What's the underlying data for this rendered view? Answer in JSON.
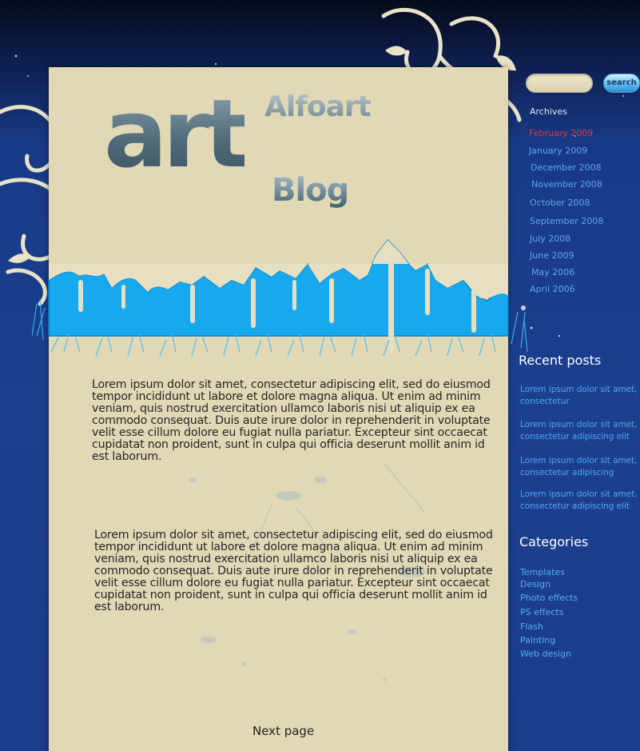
{
  "logo": {
    "art": "art",
    "name": "Alfoart",
    "blog": "Blog"
  },
  "articles": [
    "Lorem ipsum dolor sit amet, consectetur adipiscing elit, sed do eiusmod tempor incididunt ut labore et dolore magna aliqua. Ut enim ad minim veniam, quis nostrud exercitation ullamco laboris nisi ut aliquip ex ea commodo consequat. Duis aute irure dolor in reprehenderit in voluptate velit esse cillum dolore eu fugiat nulla pariatur. Excepteur sint occaecat cupidatat non proident, sunt in culpa qui officia deserunt mollit anim id est laborum.",
    "Lorem ipsum dolor sit amet, consectetur adipiscing elit, sed do eiusmod tempor incididunt ut labore et dolore magna aliqua. Ut enim ad minim veniam, quis nostrud exercitation ullamco laboris nisi ut aliquip ex ea commodo consequat. Duis aute irure dolor in reprehenderit in voluptate velit esse cillum dolore eu fugiat nulla pariatur. Excepteur sint occaecat cupidatat non proident, sunt in culpa qui officia deserunt mollit anim id est laborum."
  ],
  "next_page": "Next page",
  "search": {
    "placeholder": "",
    "button": "search"
  },
  "archives": {
    "title": "Archives",
    "items": [
      "February 2009",
      "January 2009",
      "December 2008",
      "November 2008",
      "October 2008",
      "September 2008",
      "July 2008",
      "June 2009",
      "May 2006",
      "April 2006"
    ],
    "active_color": "#e8344e"
  },
  "recent_posts": {
    "title": "Recent posts",
    "items": [
      "Lorem ipsum dolor sit amet, consectetur",
      "Lorem ipsum dolor sit amet, consectetur adipiscing elit",
      "Lorem ipsum dolor sit amet, consectetur adipiscing",
      "Lorem ipsum dolor sit amet, consectetur adipiscing elit"
    ]
  },
  "categories": {
    "title": "Categories",
    "items": [
      "Templates",
      "Design",
      "Photo effects",
      "PS effects",
      "Flash",
      "Painting",
      "Web design"
    ]
  },
  "colors": {
    "panel": "#e1d9b6",
    "paint_blue": "#17a9ef",
    "link_blue": "#5fa6ea",
    "background": "#1c3f8e"
  }
}
